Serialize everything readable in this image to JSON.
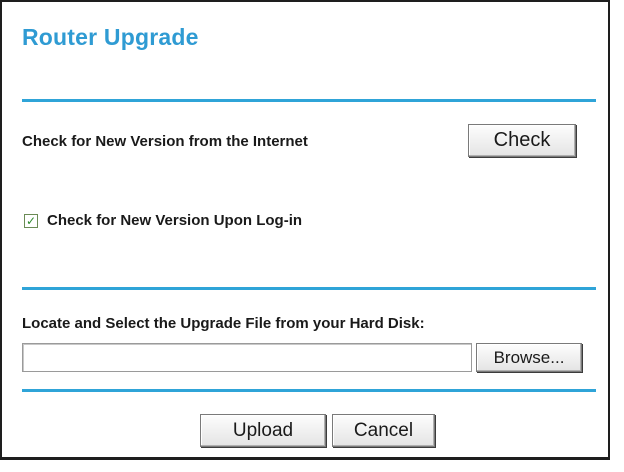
{
  "page": {
    "title": "Router Upgrade"
  },
  "online_check": {
    "label": "Check for New Version from the Internet",
    "button_label": "Check"
  },
  "login_check": {
    "checked": true,
    "check_glyph": "✓",
    "label": "Check for New Version Upon Log-in"
  },
  "file_upload": {
    "label": "Locate and Select the Upgrade File from your Hard Disk:",
    "file_value": "",
    "browse_label": "Browse..."
  },
  "actions": {
    "upload_label": "Upload",
    "cancel_label": "Cancel"
  },
  "colors": {
    "title": "#2f9bd3",
    "rule": "#2fa4d8",
    "text": "#1a1a1a",
    "checkmark": "#2d8a2d"
  }
}
